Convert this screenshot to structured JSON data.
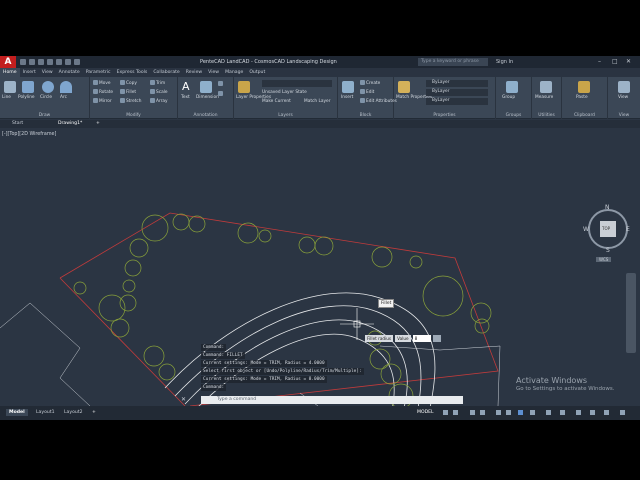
{
  "app": {
    "logo": "A",
    "title": "PenteCAD LandCAD - CosmosCAD Landscaping Design",
    "search_placeholder": "Type a keyword or phrase",
    "signin": "Sign In"
  },
  "ribbon_tabs": [
    "Home",
    "Insert",
    "View",
    "Annotate",
    "Parametric",
    "Express Tools",
    "Collaborate",
    "Review",
    "View",
    "Manage",
    "Output"
  ],
  "ribbon": {
    "draw": {
      "label": "Draw",
      "items": [
        "Line",
        "Polyline",
        "Circle",
        "Arc"
      ]
    },
    "modify": {
      "label": "Modify",
      "items": [
        "Move",
        "Rotate",
        "Trim",
        "Copy",
        "Mirror",
        "Fillet",
        "Stretch",
        "Scale",
        "Array"
      ]
    },
    "annotation": {
      "label": "Annotation",
      "items": [
        "Text",
        "Dimension",
        "Leader",
        "Table"
      ]
    },
    "layers": {
      "label": "Layers",
      "items": [
        "Layer Properties",
        "Unsaved Layer State",
        "Make Current",
        "Match Layer"
      ]
    },
    "block": {
      "label": "Block",
      "items": [
        "Insert",
        "Create",
        "Edit",
        "Edit Attributes"
      ]
    },
    "properties": {
      "label": "Properties",
      "items": [
        "Match Properties",
        "ByLayer",
        "ByLayer",
        "ByLayer"
      ]
    },
    "groups": {
      "label": "Groups",
      "items": [
        "Group"
      ]
    },
    "utilities": {
      "label": "Utilities",
      "items": [
        "Measure"
      ]
    },
    "clipboard": {
      "label": "Clipboard",
      "items": [
        "Paste"
      ]
    },
    "view": {
      "label": "View",
      "items": [
        "View"
      ]
    }
  },
  "doc_tabs": [
    "Start",
    "Drawing1*"
  ],
  "viewport_label": "[-][Top][2D Wireframe]",
  "compass": {
    "n": "N",
    "s": "S",
    "e": "E",
    "w": "W",
    "top": "TOP",
    "wcs": "WCS"
  },
  "tooltip": "Fillet",
  "dynamic_input": {
    "label1": "Fillet radius",
    "label2": "Value",
    "value": "8"
  },
  "command_history": [
    "Command:",
    "Command: FILLET",
    "Current settings: Mode = TRIM, Radius = 4.0000",
    "Select first object or [Undo/Polyline/Radius/Trim/Multiple]:",
    "Current settings: Mode = TRIM, Radius = 8.0000",
    "Command:"
  ],
  "command_placeholder": "Type a command",
  "layout_tabs": [
    "Model",
    "Layout1",
    "Layout2"
  ],
  "status_model": "MODEL",
  "watermark": {
    "line1": "Activate Windows",
    "line2": "Go to Settings to activate Windows."
  },
  "colors": {
    "canvas": "#2b3543",
    "tree": "#8aa33a",
    "boundary": "#c23b3b",
    "path": "#e6e8ea"
  }
}
